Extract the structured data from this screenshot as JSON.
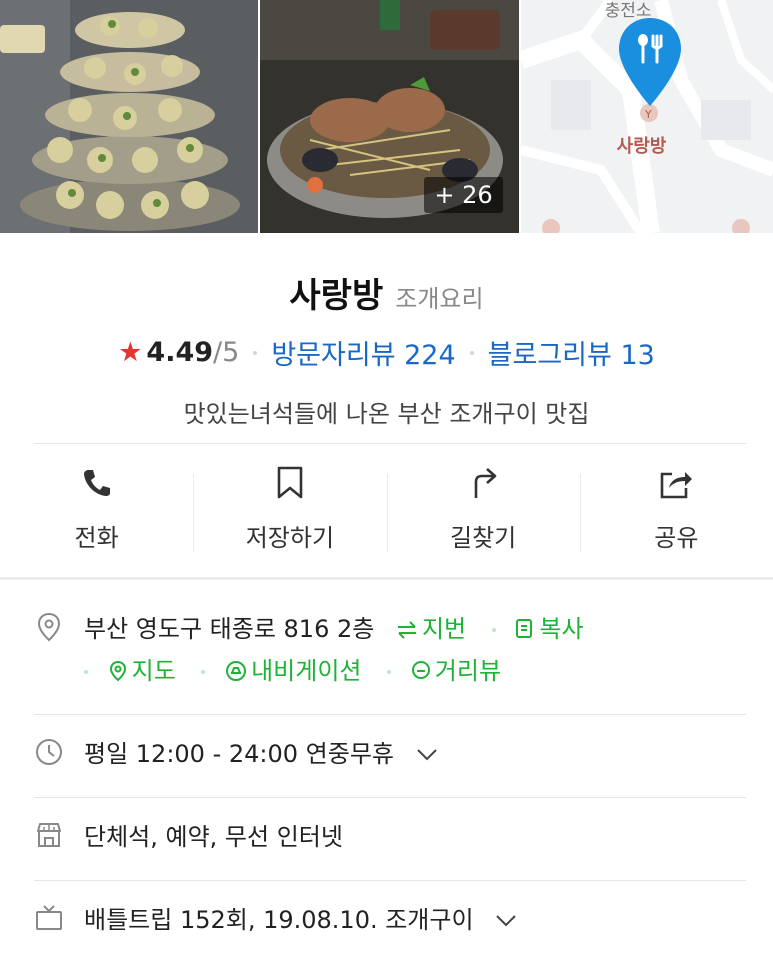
{
  "photos": {
    "more_count": "+ 26",
    "map_label_top": "충전소",
    "map_label": "사랑방"
  },
  "place": {
    "name": "사랑방",
    "category": "조개요리",
    "rating": "4.49",
    "rating_scale": "/5",
    "visitor_reviews": "방문자리뷰 224",
    "blog_reviews": "블로그리뷰 13",
    "description": "맛있는녀석들에 나온 부산 조개구이 맛집"
  },
  "actions": [
    {
      "label": "전화",
      "icon": "phone-icon"
    },
    {
      "label": "저장하기",
      "icon": "bookmark-icon"
    },
    {
      "label": "길찾기",
      "icon": "directions-icon"
    },
    {
      "label": "공유",
      "icon": "share-icon"
    }
  ],
  "info": {
    "address": "부산 영도구 태종로 816 2층",
    "lot_number": "지번",
    "copy": "복사",
    "map": "지도",
    "navigation": "내비게이션",
    "street_view": "거리뷰",
    "hours": "평일 12:00 - 24:00 연중무휴",
    "amenities": "단체석, 예약, 무선 인터넷",
    "tv": "배틀트립 152회, 19.08.10. 조개구이"
  },
  "colors": {
    "accent_blue": "#1a68c6",
    "accent_green": "#1db436",
    "star_red": "#e7352f",
    "map_pin": "#1a8fe0"
  }
}
